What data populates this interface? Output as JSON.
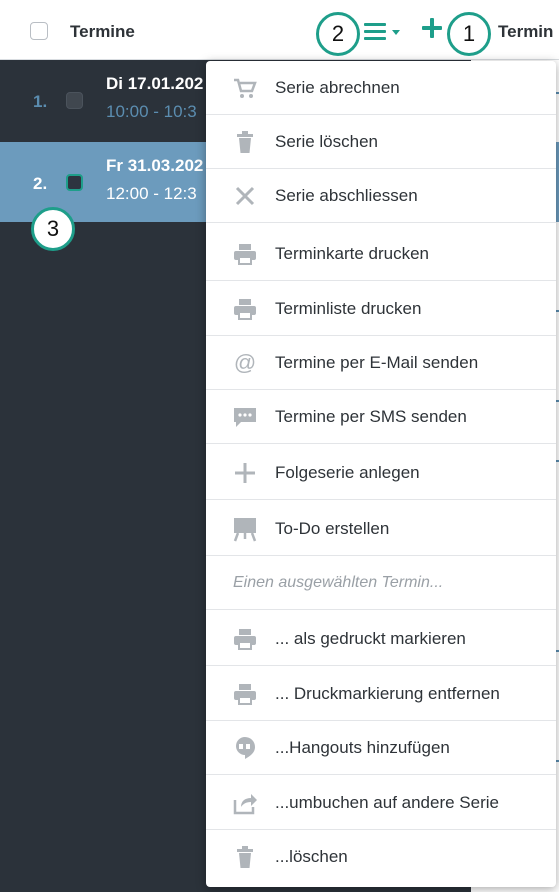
{
  "header": {
    "title": "Termine",
    "right_label": "Termin"
  },
  "rows": [
    {
      "number": "1.",
      "date": "Di 17.01.202",
      "time": "10:00 - 10:3"
    },
    {
      "number": "2.",
      "date": "Fr 31.03.202",
      "time": "12:00 - 12:3"
    }
  ],
  "markers": {
    "m1": "1",
    "m2": "2",
    "m3": "3"
  },
  "menu": {
    "items": [
      {
        "label": "Serie abrechnen",
        "icon": "cart-icon"
      },
      {
        "label": "Serie löschen",
        "icon": "trash-icon"
      },
      {
        "label": "Serie abschliessen",
        "icon": "close-icon"
      },
      {
        "label": "Terminkarte drucken",
        "icon": "printer-icon"
      },
      {
        "label": "Terminliste drucken",
        "icon": "printer-icon"
      },
      {
        "label": "Termine per E-Mail senden",
        "icon": "at-icon"
      },
      {
        "label": "Termine per SMS senden",
        "icon": "chat-icon"
      },
      {
        "label": "Folgeserie anlegen",
        "icon": "plus-icon"
      },
      {
        "label": "To-Do erstellen",
        "icon": "easel-icon"
      }
    ],
    "section_label": "Einen ausgewählten Termin...",
    "sub_items": [
      {
        "label": "... als gedruckt markieren",
        "icon": "printer-icon"
      },
      {
        "label": "... Druckmarkierung entfernen",
        "icon": "printer-icon"
      },
      {
        "label": "...Hangouts hinzufügen",
        "icon": "hangouts-icon"
      },
      {
        "label": "...umbuchen auf andere Serie",
        "icon": "share-icon"
      },
      {
        "label": "...löschen",
        "icon": "trash-icon"
      }
    ]
  },
  "colors": {
    "accent": "#1e9e8a",
    "list_bg": "#2b323a",
    "selected_row": "#6c9bbd",
    "link_blue": "#5b8db0"
  }
}
